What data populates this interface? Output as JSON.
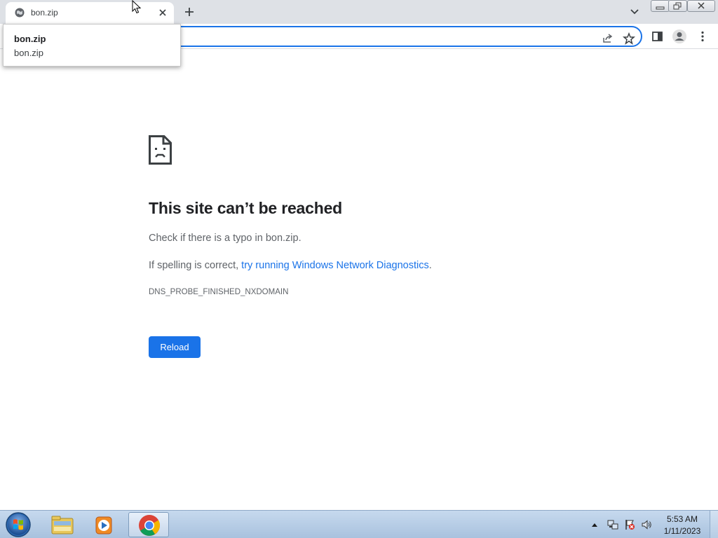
{
  "tab": {
    "title": "bon.zip"
  },
  "popup": {
    "title": "bon.zip",
    "subtitle": "bon.zip"
  },
  "page": {
    "heading": "This site can’t be reached",
    "check_text": "Check if there is a typo in bon.zip.",
    "spelling_prefix": "If spelling is correct, ",
    "diagnostics_link": "try running Windows Network Diagnostics",
    "spelling_suffix": ".",
    "error_code": "DNS_PROBE_FINISHED_NXDOMAIN",
    "reload_label": "Reload"
  },
  "taskbar": {
    "time": "5:53 AM",
    "date": "1/11/2023",
    "pinned": [
      "explorer-icon",
      "media-player-icon",
      "chrome-icon"
    ]
  },
  "colors": {
    "accent": "#1a73e8",
    "tabstrip": "#dee1e6",
    "text": "#202124"
  }
}
